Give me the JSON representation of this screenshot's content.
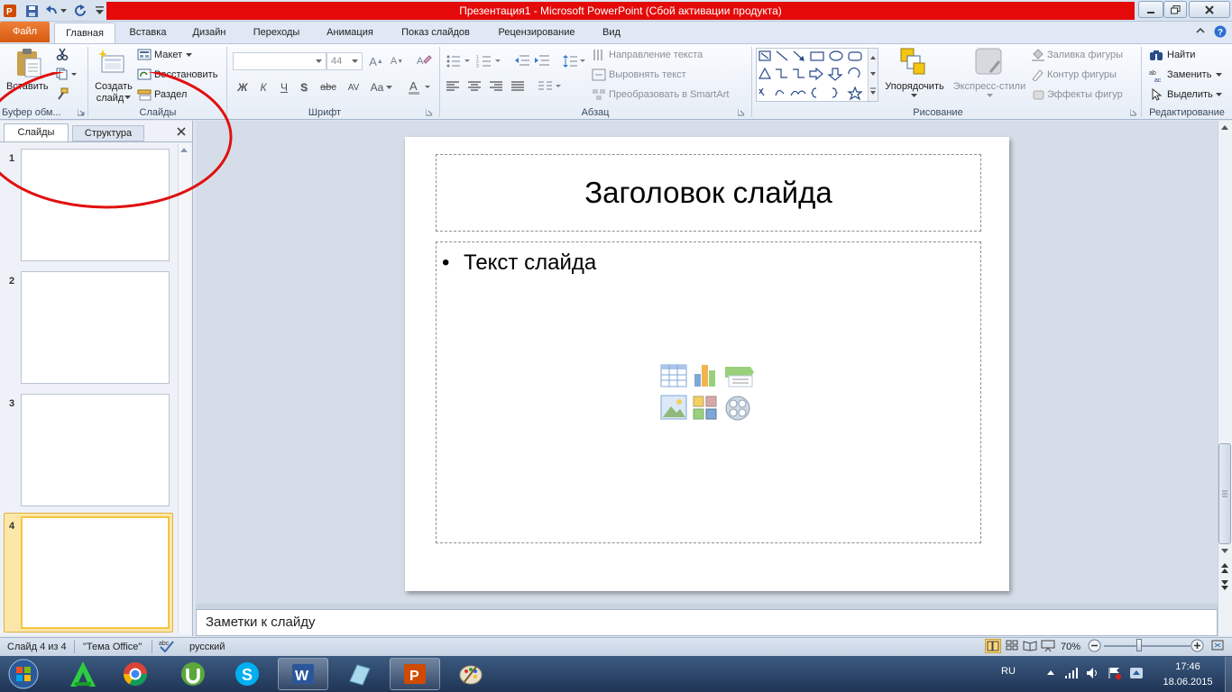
{
  "window": {
    "title": "Презентация1  -  Microsoft PowerPoint (Сбой активации продукта)"
  },
  "tabs": [
    "Файл",
    "Главная",
    "Вставка",
    "Дизайн",
    "Переходы",
    "Анимация",
    "Показ слайдов",
    "Рецензирование",
    "Вид"
  ],
  "ribbon": {
    "clipboard": {
      "paste": "Вставить",
      "group": "Буфер обм..."
    },
    "slides": {
      "new_slide_line1": "Создать",
      "new_slide_line2": "слайд",
      "layout": "Макет",
      "reset": "Восстановить",
      "section": "Раздел",
      "group": "Слайды"
    },
    "font": {
      "size": "44",
      "group": "Шрифт",
      "bold": "Ж",
      "italic": "К",
      "underline": "Ч",
      "strike": "abc",
      "spacing": "AV",
      "case": "Aa"
    },
    "paragraph": {
      "text_direction": "Направление текста",
      "align_text": "Выровнять текст",
      "smartart": "Преобразовать в SmartArt",
      "group": "Абзац"
    },
    "drawing": {
      "arrange": "Упорядочить",
      "quick_styles": "Экспресс-стили",
      "fill": "Заливка фигуры",
      "outline": "Контур фигуры",
      "effects": "Эффекты фигур",
      "group": "Рисование"
    },
    "editing": {
      "find": "Найти",
      "replace": "Заменить",
      "select": "Выделить",
      "group": "Редактирование"
    }
  },
  "left_pane": {
    "tab_slides": "Слайды",
    "tab_outline": "Структура",
    "slides": [
      {
        "number": "1"
      },
      {
        "number": "2"
      },
      {
        "number": "3"
      },
      {
        "number": "4"
      }
    ]
  },
  "slide": {
    "title": "Заголовок слайда",
    "body_bullet": "Текст слайда"
  },
  "notes": {
    "placeholder": "Заметки к слайду"
  },
  "status": {
    "slide_info": "Слайд 4 из 4",
    "theme": "\"Тема Office\"",
    "language": "русский",
    "zoom": "70%",
    "zoom_level": 0.4
  },
  "taskbar": {
    "lang": "RU",
    "time": "17:46",
    "date": "18.06.2015"
  },
  "colors": {
    "title_red": "#e40a0a",
    "file_tab": "#d65a10",
    "annotation_circle": "#e01010",
    "selected_slide": "#f5c542"
  }
}
